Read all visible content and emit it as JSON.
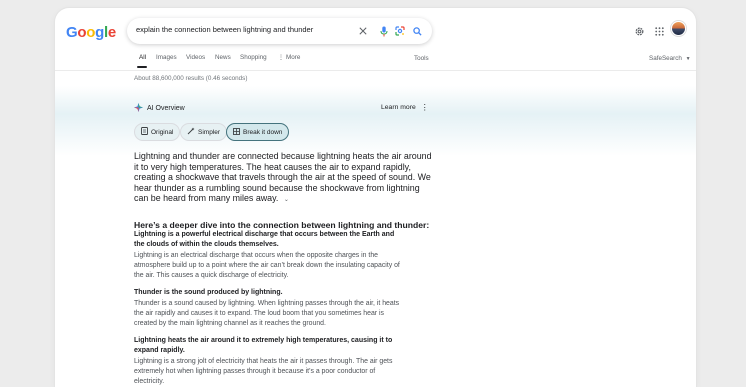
{
  "logo": "Google",
  "search": {
    "query": "explain the connection between lightning and thunder"
  },
  "tabs": [
    {
      "label": "All",
      "active": true
    },
    {
      "label": "Images"
    },
    {
      "label": "Videos"
    },
    {
      "label": "News"
    },
    {
      "label": "Shopping"
    },
    {
      "label": "More"
    }
  ],
  "tools_label": "Tools",
  "safesearch_label": "SafeSearch",
  "result_stats": "About 88,600,000 results (0.46 seconds)",
  "ai_overview": {
    "title": "AI Overview",
    "learn_more": "Learn more",
    "chips": [
      {
        "label": "Original"
      },
      {
        "label": "Simpler"
      },
      {
        "label": "Break it down",
        "selected": true
      }
    ],
    "summary": "Lightning and thunder are connected because lightning heats the air around it to very high temperatures. The heat causes the air to expand rapidly, creating a shockwave that travels through the air at the speed of sound. We hear thunder as a rumbling sound because the shockwave from lightning can be heard from many miles away.",
    "deeper_heading": "Here’s a deeper dive into the connection between lightning and thunder:",
    "sections": [
      {
        "title": "Lightning is a powerful electrical discharge that occurs between the Earth and the clouds of within the clouds themselves.",
        "body": "Lightning is an electrical discharge that occurs when the opposite charges in the atmosphere build up to a point where the air can’t break down the insulating capacity of the air. This causes a quick discharge of electricity."
      },
      {
        "title": "Thunder is the sound produced by lightning.",
        "body": "Thunder is a sound caused by lightning. When lightning passes through the air, it heats the air rapidly and causes it to expand. The loud boom that you sometimes hear is created by the main lightning channel as it reaches the ground."
      },
      {
        "title": "Lightning heats the air around it to extremely high temperatures, causing it to expand rapidly.",
        "body": "Lightning is a strong jolt of electricity that heats the air it passes through. The air gets extremely hot when lightning passes through it because it’s a poor conductor of electricity."
      }
    ]
  },
  "colors": {
    "google_blue": "#4285F4",
    "google_red": "#EA4335",
    "google_yellow": "#FBBC05",
    "google_green": "#34A853",
    "chip_selected_border": "#44737d"
  },
  "icons": [
    "clear-icon",
    "microphone-icon",
    "lens-icon",
    "search-icon",
    "settings-icon",
    "apps-icon",
    "avatar",
    "sparkle-icon",
    "more-vert-icon",
    "document-icon",
    "simplify-icon",
    "breakdown-icon",
    "chevron-down-icon"
  ]
}
